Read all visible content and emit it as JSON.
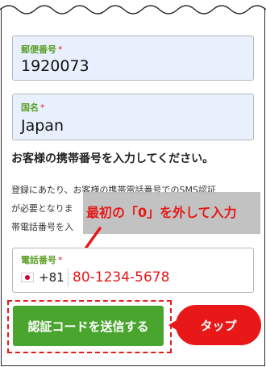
{
  "postal_code": {
    "label": "郵便番号",
    "required_mark": "*",
    "value": "1920073"
  },
  "country": {
    "label": "国名",
    "required_mark": "*",
    "value": "Japan"
  },
  "heading": "お客様の携帯番号を入力してください。",
  "description": {
    "line1": "登録にあたり、お客様の携帯電話番号でのSMS認証",
    "line2": "が必要となりま",
    "line3": "帯電話番号を入"
  },
  "annotation": {
    "instruction": "最初の「0」を外して入力",
    "tap_label": "タップ"
  },
  "phone": {
    "label": "電話番号",
    "required_mark": "*",
    "country_code": "+81",
    "number": "80-1234-5678"
  },
  "send_button_label": "認証コードを送信する",
  "colors": {
    "label_green": "#5da12a",
    "annotation_red": "#e81818",
    "button_green": "#4aa52f",
    "field_blue": "#e8f0fe"
  }
}
